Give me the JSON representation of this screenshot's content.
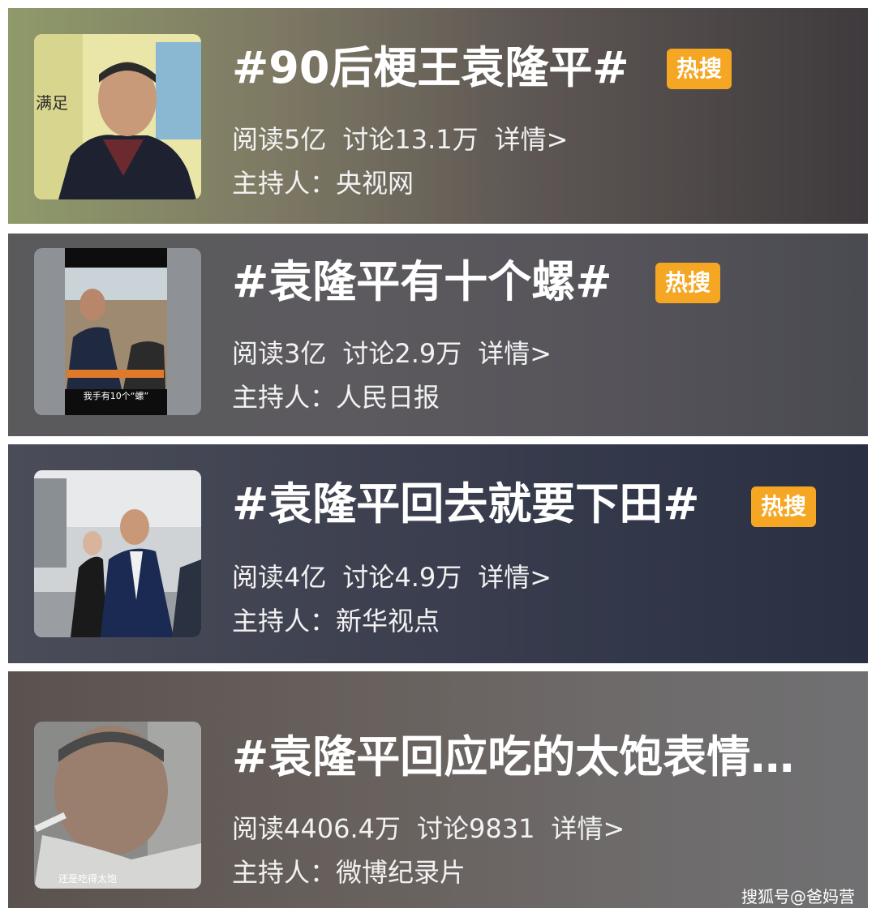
{
  "topics": [
    {
      "title": "#90后梗王袁隆平#",
      "badge": "热搜",
      "read": "阅读5亿",
      "discuss": "讨论13.1万",
      "details": "详情>",
      "host": "主持人：央视网",
      "thumb_caption": "满足"
    },
    {
      "title": "#袁隆平有十个螺#",
      "badge": "热搜",
      "read": "阅读3亿",
      "discuss": "讨论2.9万",
      "details": "详情>",
      "host": "主持人：人民日报",
      "thumb_caption": "我手有10个“螺”"
    },
    {
      "title": "#袁隆平回去就要下田#",
      "badge": "热搜",
      "read": "阅读4亿",
      "discuss": "讨论4.9万",
      "details": "详情>",
      "host": "主持人：新华视点"
    },
    {
      "title": "#袁隆平回应吃的太饱表情…",
      "read": "阅读4406.4万",
      "discuss": "讨论9831",
      "details": "详情>",
      "host": "主持人：微博纪录片",
      "thumb_caption": "还是吃得太饱"
    }
  ],
  "watermark": "搜狐号@爸妈营",
  "colors": {
    "badge": "#f5a623",
    "text": "#ffffff"
  }
}
